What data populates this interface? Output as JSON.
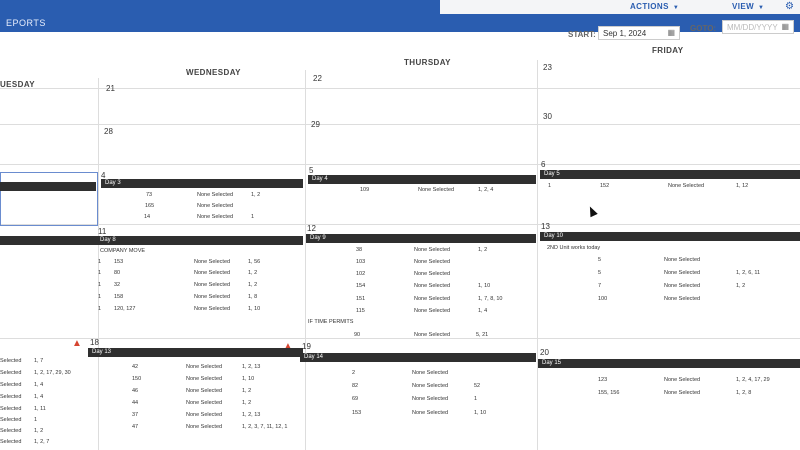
{
  "header": {
    "title": "EPORTS"
  },
  "menu": {
    "actions": "ACTIONS",
    "view": "VIEW"
  },
  "controls": {
    "start_label": "START:",
    "start_value": "Sep 1, 2024",
    "goto_label": "GOTO:",
    "goto_placeholder": "MM/DD/YYYY"
  },
  "days": {
    "tuesday": "UESDAY",
    "wednesday": "WEDNESDAY",
    "thursday": "THURSDAY",
    "friday": "FRIDAY"
  },
  "week1": {
    "wed": "21",
    "thu": "22",
    "fri": "23"
  },
  "week2": {
    "wed": "28",
    "thu": "29",
    "fri": "30"
  },
  "week3": {
    "wed": {
      "date": "4",
      "bar": "Day 3",
      "rows": [
        {
          "id": "73",
          "status": "None Selected",
          "list": "1, 2"
        },
        {
          "id": "165",
          "status": "None Selected",
          "list": ""
        },
        {
          "id": "14",
          "status": "None Selected",
          "list": "1"
        }
      ]
    },
    "thu": {
      "date": "5",
      "bar": "Day 4",
      "rows": [
        {
          "id": "109",
          "status": "None Selected",
          "list": "1, 2, 4"
        }
      ]
    },
    "fri": {
      "date": "6",
      "bar": "Day 5",
      "rows": [
        {
          "a": "1",
          "id": "152",
          "status": "None Selected",
          "list": "1, 12"
        }
      ]
    }
  },
  "week4": {
    "wed": {
      "date": "11",
      "bar": "Day 8",
      "note": "COMPANY MOVE",
      "rows": [
        {
          "a": "1",
          "id": "153",
          "status": "None Selected",
          "list": "1, 56"
        },
        {
          "a": "1",
          "id": "80",
          "status": "None Selected",
          "list": "1, 2"
        },
        {
          "a": "1",
          "id": "32",
          "status": "None Selected",
          "list": "1, 2"
        },
        {
          "a": "1",
          "id": "158",
          "status": "None Selected",
          "list": "1, 8"
        },
        {
          "a": "1",
          "id": "120, 127",
          "status": "None Selected",
          "list": "1, 10"
        }
      ]
    },
    "thu": {
      "date": "12",
      "bar": "Day 9",
      "rows": [
        {
          "id": "38",
          "status": "None Selected",
          "list": "1, 2"
        },
        {
          "id": "103",
          "status": "None Selected",
          "list": ""
        },
        {
          "id": "102",
          "status": "None Selected",
          "list": ""
        },
        {
          "id": "154",
          "status": "None Selected",
          "list": "1, 10"
        },
        {
          "id": "151",
          "status": "None Selected",
          "list": "1, 7, 8, 10"
        },
        {
          "id": "115",
          "status": "None Selected",
          "list": "1, 4"
        }
      ],
      "note2": "IF TIME PERMITS",
      "extra": {
        "id": "90",
        "status": "None Selected",
        "list": "5, 21"
      }
    },
    "fri": {
      "date": "13",
      "bar": "Day 10",
      "note": "2ND Unit works today",
      "rows": [
        {
          "id": "5",
          "status": "None Selected",
          "list": ""
        },
        {
          "id": "5",
          "status": "None Selected",
          "list": "1, 2, 6, 11"
        },
        {
          "id": "7",
          "status": "None Selected",
          "list": "1, 2"
        },
        {
          "id": "100",
          "status": "None Selected",
          "list": ""
        }
      ]
    }
  },
  "week5": {
    "tue": {
      "rows": [
        {
          "status": "Selected",
          "list": "1, 7"
        },
        {
          "status": "Selected",
          "list": "1, 2, 17, 29, 30"
        },
        {
          "status": "Selected",
          "list": "1, 4"
        },
        {
          "status": "Selected",
          "list": "1, 4"
        },
        {
          "status": "Selected",
          "list": "1, 11"
        },
        {
          "status": "Selected",
          "list": "1"
        },
        {
          "status": "Selected",
          "list": "1, 2"
        },
        {
          "status": "Selected",
          "list": "1, 2, 7"
        }
      ]
    },
    "wed": {
      "date": "18",
      "bar": "Day 13",
      "rows": [
        {
          "id": "42",
          "status": "None Selected",
          "list": "1, 2, 13"
        },
        {
          "id": "150",
          "status": "None Selected",
          "list": "1, 10"
        },
        {
          "id": "46",
          "status": "None Selected",
          "list": "1, 2"
        },
        {
          "id": "44",
          "status": "None Selected",
          "list": "1, 2"
        },
        {
          "id": "37",
          "status": "None Selected",
          "list": "1, 2, 13"
        },
        {
          "id": "47",
          "status": "None Selected",
          "list": "1, 2, 3, 7, 11, 12, 1"
        }
      ]
    },
    "thu": {
      "date": "19",
      "bar": "Day 14",
      "rows": [
        {
          "id": "2",
          "status": "None Selected",
          "list": ""
        },
        {
          "id": "82",
          "status": "None Selected",
          "list": "52"
        },
        {
          "id": "69",
          "status": "None Selected",
          "list": "1"
        },
        {
          "id": "153",
          "status": "None Selected",
          "list": "1, 10"
        }
      ]
    },
    "fri": {
      "date": "20",
      "bar": "Day 15",
      "rows": [
        {
          "id": "123",
          "status": "None Selected",
          "list": "1, 2, 4, 17, 29"
        },
        {
          "id": "155, 156",
          "status": "None Selected",
          "list": "1, 2, 8"
        }
      ]
    }
  },
  "icons": {
    "gear": "gear-icon",
    "calendar": "calendar-icon",
    "warning": "warning-icon"
  },
  "colors": {
    "header": "#2a5db0",
    "daybar": "#2f2f2f",
    "warning": "#d64531"
  }
}
